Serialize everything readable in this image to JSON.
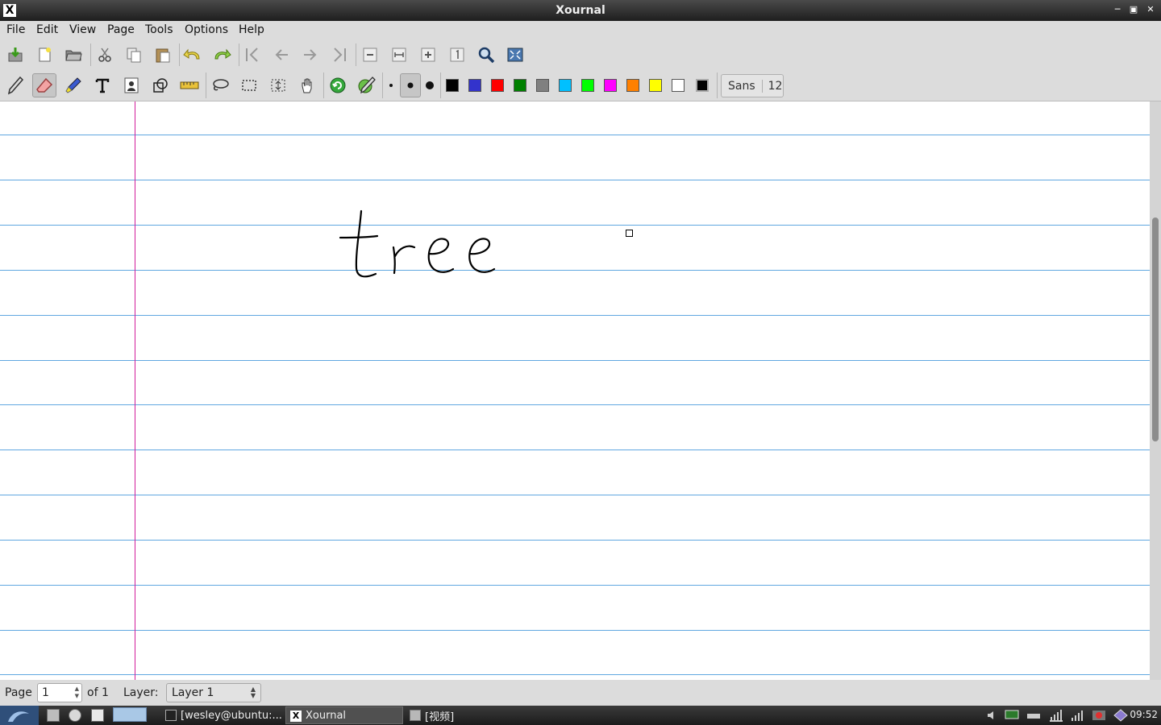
{
  "window": {
    "title": "Xournal",
    "icon_glyph": "X"
  },
  "menu": [
    "File",
    "Edit",
    "View",
    "Page",
    "Tools",
    "Options",
    "Help"
  ],
  "toolbar1": [
    "save-icon",
    "new-file-icon",
    "open-folder-icon",
    "cut-icon",
    "copy-icon",
    "paste-icon",
    "undo-icon",
    "redo-icon",
    "first-page-icon",
    "previous-page-icon",
    "next-page-icon",
    "last-page-icon",
    "zoom-out-icon",
    "zoom-fit-width-icon",
    "zoom-in-icon",
    "zoom-100-icon",
    "zoom-search-icon",
    "fullscreen-icon"
  ],
  "toolbar2": {
    "tools": [
      "pen-icon",
      "eraser-icon",
      "highlighter-icon",
      "text-icon",
      "image-icon",
      "shape-recognizer-icon",
      "ruler-icon",
      "lasso-icon",
      "rect-select-icon",
      "vertical-space-icon",
      "hand-icon",
      "default-tool-icon",
      "default-pen-icon"
    ],
    "active_tool": "eraser-icon",
    "thickness": [
      "thin",
      "medium",
      "thick"
    ],
    "active_thickness": "medium",
    "colors": [
      "#000000",
      "#3333cc",
      "#ff0000",
      "#008000",
      "#808080",
      "#00c0ff",
      "#00ff00",
      "#ff00ff",
      "#ff8000",
      "#ffff00",
      "#ffffff",
      "#000000"
    ],
    "font_name": "Sans",
    "font_size": "12"
  },
  "canvas": {
    "ink_text": "tree",
    "ruling_color": "#60a7e0",
    "margin_color": "#d11c9a"
  },
  "status": {
    "page_label": "Page",
    "page_value": "1",
    "of_label": "of 1",
    "layer_label": "Layer:",
    "layer_value": "Layer 1"
  },
  "taskbar": {
    "tasks": [
      {
        "label": "[wesley@ubuntu:...",
        "icon": "terminal-icon"
      },
      {
        "label": "Xournal",
        "icon": "xournal-icon",
        "active": true
      },
      {
        "label": "[视频]",
        "icon": "folder-icon"
      }
    ],
    "clock": "09:52"
  }
}
